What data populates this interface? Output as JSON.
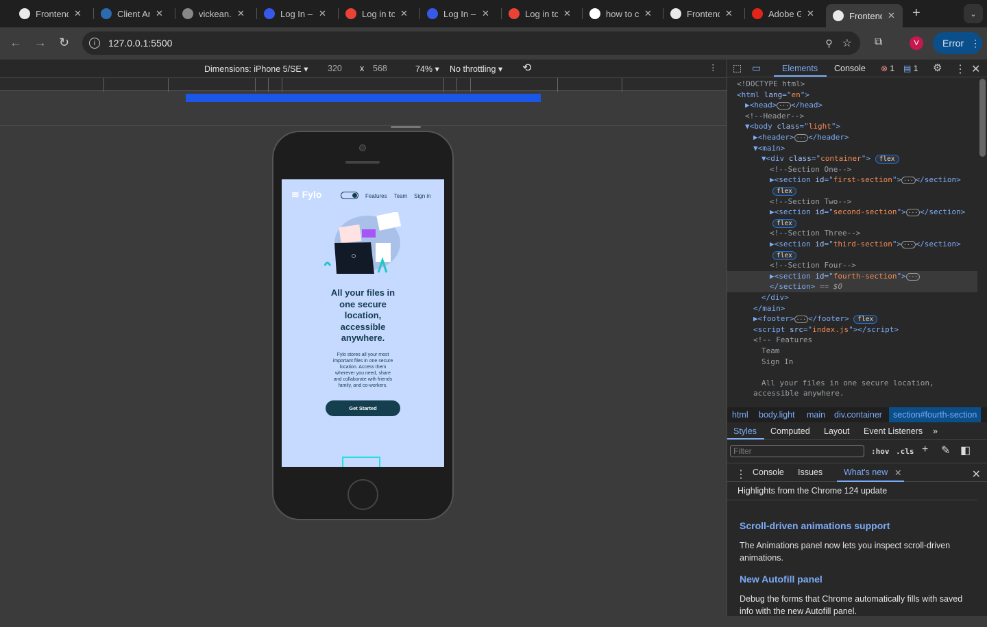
{
  "browser": {
    "tabs": [
      {
        "title": "Frontend",
        "icon": "frontend-mentor-icon"
      },
      {
        "title": "Client Area",
        "icon": "paypal-icon"
      },
      {
        "title": "vickean.",
        "icon": "globe-icon"
      },
      {
        "title": "Log In –",
        "icon": "wordpress-icon"
      },
      {
        "title": "Log in to",
        "icon": "gmail-icon"
      },
      {
        "title": "Log In –",
        "icon": "wordpress-icon"
      },
      {
        "title": "Log in to",
        "icon": "gmail-icon"
      },
      {
        "title": "how to c",
        "icon": "google-icon"
      },
      {
        "title": "Frontend",
        "icon": "frontend-mentor-icon"
      },
      {
        "title": "Adobe G",
        "icon": "adobe-icon"
      },
      {
        "title": "Frontend",
        "icon": "frontend-mentor-icon",
        "active": true
      }
    ],
    "url": "127.0.0.1:5500",
    "profile_initial": "V",
    "error_label": "Error"
  },
  "device_toolbar": {
    "dimensions": "Dimensions: iPhone 5/SE",
    "width": "320",
    "x": "x",
    "height": "568",
    "zoom": "74%",
    "throttling": "No throttling"
  },
  "site": {
    "logo": "Fylo",
    "nav": [
      "Features",
      "Team",
      "Sign in"
    ],
    "headline": "All your files in one secure location, accessible anywhere.",
    "body": "Fylo stores all your most important files in one secure location. Access them wherever you need, share and collaborate with friends family, and co-workers.",
    "cta": "Get Started",
    "colors": {
      "bg": "#c5dafe",
      "text": "#153b4f",
      "button": "#153f4f"
    }
  },
  "devtools": {
    "tabs": [
      "Elements",
      "Console"
    ],
    "errors": "1",
    "messages": "1",
    "dom": [
      {
        "d": 0,
        "t": "<!DOCTYPE html>",
        "c": "cm"
      },
      {
        "d": 0,
        "h": "<html lang=\"en\">"
      },
      {
        "d": 1,
        "h": "▶<head>…</head>"
      },
      {
        "d": 1,
        "t": "<!--Header-->",
        "c": "cm"
      },
      {
        "d": 1,
        "h": "▼<body class=\"light\">"
      },
      {
        "d": 2,
        "h": "▶<header>…</header>"
      },
      {
        "d": 2,
        "h": "▼<main>"
      },
      {
        "d": 3,
        "h": "▼<div class=\"container\">",
        "flex": true
      },
      {
        "d": 4,
        "t": "<!--Section One-->",
        "c": "cm"
      },
      {
        "d": 4,
        "h": "▶<section id=\"first-section\">…</section>"
      },
      {
        "d": 4,
        "flexonly": true
      },
      {
        "d": 4,
        "t": "<!--Section Two-->",
        "c": "cm"
      },
      {
        "d": 4,
        "h": "▶<section id=\"second-section\">…</section>"
      },
      {
        "d": 4,
        "flexonly": true
      },
      {
        "d": 4,
        "t": "<!--Section Three-->",
        "c": "cm"
      },
      {
        "d": 4,
        "h": "▶<section id=\"third-section\">…</section>"
      },
      {
        "d": 4,
        "flexonly": true
      },
      {
        "d": 4,
        "t": "<!--Section Four-->",
        "c": "cm"
      },
      {
        "d": 4,
        "h": "▶<section id=\"fourth-section\">…",
        "sel": true
      },
      {
        "d": 4,
        "h": "</section> == $0",
        "sel": true
      },
      {
        "d": 3,
        "h": "</div>"
      },
      {
        "d": 2,
        "h": "</main>"
      },
      {
        "d": 2,
        "h": "▶<footer>…</footer>",
        "flex": true
      },
      {
        "d": 2,
        "h": "<script src=\"index.js\"></script>"
      },
      {
        "d": 2,
        "t": "<!-- Features",
        "c": "cm"
      },
      {
        "d": 3,
        "t": "Team",
        "c": "cm"
      },
      {
        "d": 3,
        "t": "Sign In",
        "c": "cm"
      },
      {
        "d": 3,
        "t": "",
        "c": "cm"
      },
      {
        "d": 3,
        "t": "All your files in one secure location,",
        "c": "cm"
      },
      {
        "d": 2,
        "t": "accessible anywhere.",
        "c": "cm"
      }
    ],
    "flex_badge": "flex",
    "breadcrumb": [
      "html",
      "body.light",
      "main",
      "div.container",
      "section#fourth-section"
    ],
    "style_tabs": [
      "Styles",
      "Computed",
      "Layout",
      "Event Listeners"
    ],
    "filter_placeholder": "Filter",
    "hov": ":hov",
    "cls": ".cls",
    "drawer_tabs": [
      "Console",
      "Issues",
      "What's new"
    ],
    "whatsnew": {
      "highlights": "Highlights from the Chrome 124 update",
      "items": [
        {
          "title": "Scroll-driven animations support",
          "text": "The Animations panel now lets you inspect scroll-driven animations."
        },
        {
          "title": "New Autofill panel",
          "text": "Debug the forms that Chrome automatically fills with saved info with the new Autofill panel."
        }
      ]
    }
  }
}
